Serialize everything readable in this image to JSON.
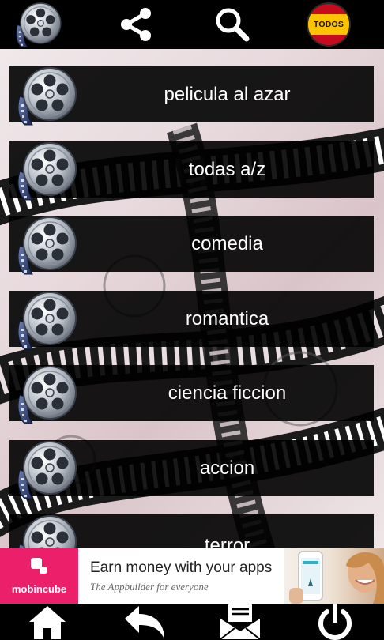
{
  "header": {
    "icons": [
      "film-reel-icon",
      "share-icon",
      "search-icon",
      "spain-flag-icon"
    ],
    "language_badge": "TODOS"
  },
  "menu": {
    "items": [
      {
        "label": "pelicula al azar"
      },
      {
        "label": "todas a/z"
      },
      {
        "label": "comedia"
      },
      {
        "label": "romantica"
      },
      {
        "label": "ciencia ficcion"
      },
      {
        "label": "accion"
      },
      {
        "label": "terror"
      }
    ]
  },
  "ad": {
    "brand": "mobincube",
    "title": "Earn money with your apps",
    "subtitle": "The Appbuilder for everyone",
    "brand_color": "#ec1f6a"
  },
  "bottom_nav": {
    "icons": [
      "home-icon",
      "back-icon",
      "mail-icon",
      "power-icon"
    ]
  }
}
